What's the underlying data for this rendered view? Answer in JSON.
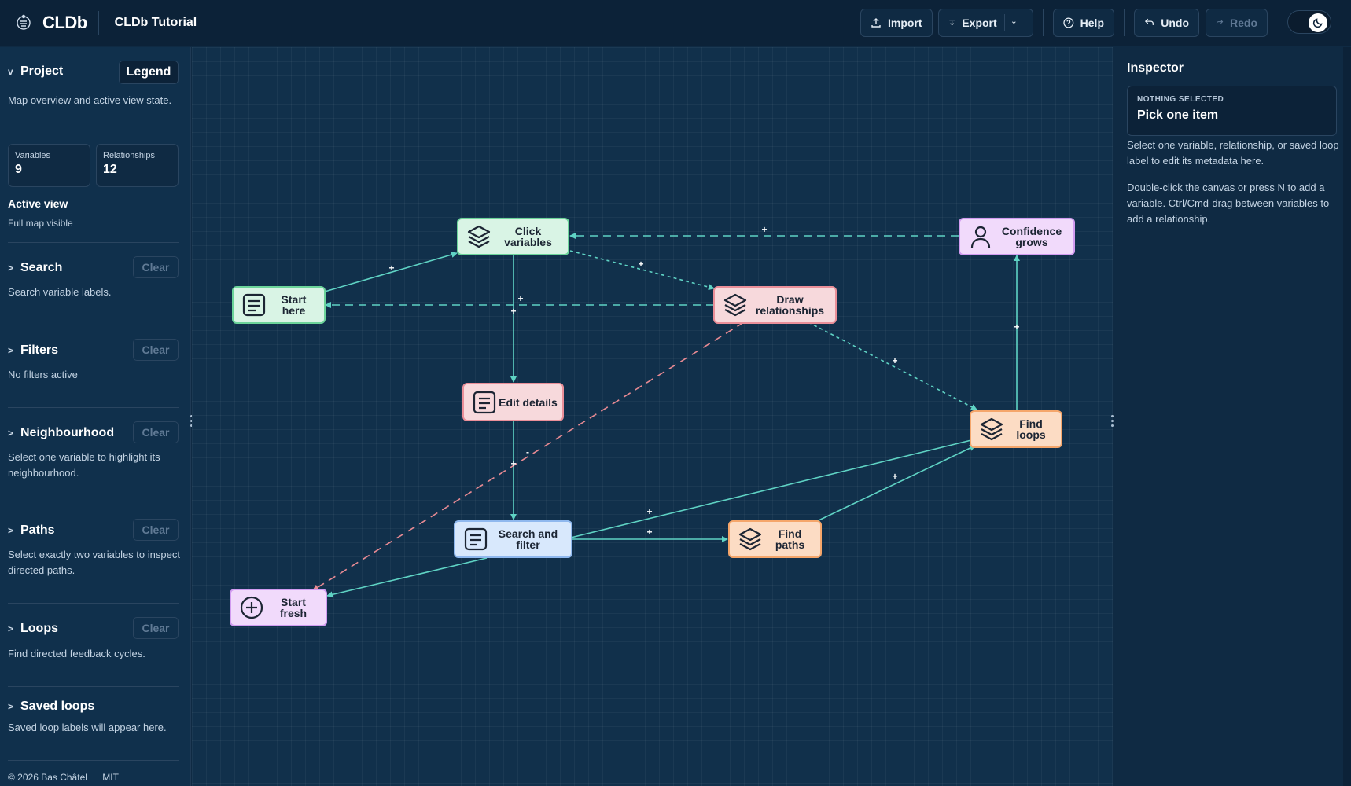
{
  "app": {
    "name": "CLDb",
    "document_title": "CLDb Tutorial"
  },
  "toolbar": {
    "import_label": "Import",
    "export_label": "Export",
    "help_label": "Help",
    "undo_label": "Undo",
    "redo_label": "Redo"
  },
  "sidebar": {
    "project": {
      "title": "Project",
      "legend_label": "Legend",
      "description": "Map overview and active view state.",
      "variables_label": "Variables",
      "variables_count": "9",
      "relationships_label": "Relationships",
      "relationships_count": "12",
      "active_view_title": "Active view",
      "active_view_value": "Full map visible"
    },
    "search": {
      "title": "Search",
      "clear": "Clear",
      "description": "Search variable labels."
    },
    "filters": {
      "title": "Filters",
      "clear": "Clear",
      "description": "No filters active"
    },
    "neighbourhood": {
      "title": "Neighbourhood",
      "clear": "Clear",
      "description": "Select one variable to highlight its neighbourhood."
    },
    "paths": {
      "title": "Paths",
      "clear": "Clear",
      "description": "Select exactly two variables to inspect directed paths."
    },
    "loops": {
      "title": "Loops",
      "clear": "Clear",
      "description": "Find directed feedback cycles."
    },
    "saved_loops": {
      "title": "Saved loops",
      "description": "Saved loop labels will appear here."
    },
    "footer": {
      "copyright": "© 2026 Bas Châtel",
      "license": "MIT"
    }
  },
  "canvas": {
    "nodes": {
      "click_variables": "Click variables",
      "confidence_grows": "Confidence grows",
      "start_here": "Start here",
      "draw_relationships": "Draw relationships",
      "edit_details": "Edit details",
      "find_loops": "Find loops",
      "search_and_filter": "Search and filter",
      "find_paths": "Find paths",
      "start_fresh": "Start fresh"
    },
    "polarity": {
      "plus": "+",
      "minus": "-"
    },
    "colors": {
      "edge": "#5fd3c4",
      "negative_edge": "#e88a93"
    }
  },
  "inspector": {
    "title": "Inspector",
    "badge": "NOTHING SELECTED",
    "pick": "Pick one item",
    "help_1": "Select one variable, relationship, or saved loop label to edit its metadata here.",
    "help_2": "Double-click the canvas or press N to add a variable. Ctrl/Cmd-drag between variables to add a relationship."
  }
}
